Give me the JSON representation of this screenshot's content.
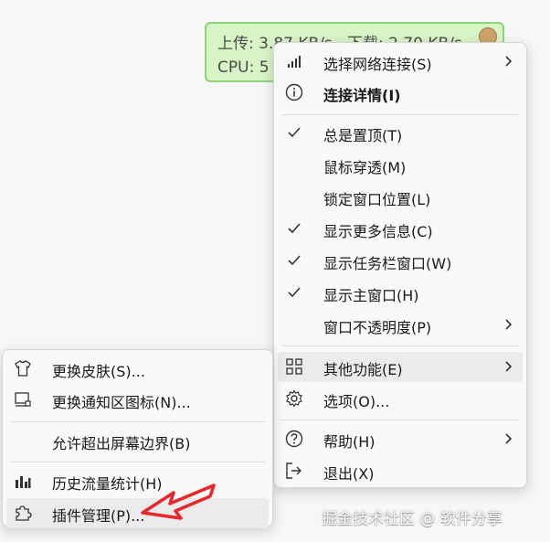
{
  "widget": {
    "upload_text": "上传: 3.87 KB/s",
    "download_text": "下载: 2.70 KB/s",
    "cpu_text": "CPU: 5"
  },
  "main_menu": {
    "items": [
      {
        "label": "选择网络连接(S)",
        "icon": "signal-bars-icon",
        "submenu": true
      },
      {
        "label": "连接详情(I)",
        "icon": "info-icon",
        "bold": true
      },
      {
        "label": "总是置顶(T)",
        "checked": true
      },
      {
        "label": "鼠标穿透(M)"
      },
      {
        "label": "锁定窗口位置(L)"
      },
      {
        "label": "显示更多信息(C)",
        "checked": true
      },
      {
        "label": "显示任务栏窗口(W)",
        "checked": true
      },
      {
        "label": "显示主窗口(H)",
        "checked": true
      },
      {
        "label": "窗口不透明度(P)",
        "submenu": true
      },
      {
        "label": "其他功能(E)",
        "icon": "grid-icon",
        "submenu": true,
        "highlighted": true
      },
      {
        "label": "选项(O)...",
        "icon": "gear-icon"
      },
      {
        "label": "帮助(H)",
        "icon": "help-icon",
        "submenu": true
      },
      {
        "label": "退出(X)",
        "icon": "exit-icon"
      }
    ]
  },
  "sub_menu": {
    "items": [
      {
        "label": "更换皮肤(S)...",
        "icon": "shirt-icon"
      },
      {
        "label": "更换通知区图标(N)...",
        "icon": "tray-icon"
      },
      {
        "label": "允许超出屏幕边界(B)"
      },
      {
        "label": "历史流量统计(H)",
        "icon": "bar-chart-icon"
      },
      {
        "label": "插件管理(P)...",
        "icon": "puzzle-icon",
        "highlighted": true
      }
    ]
  },
  "watermark": "掘金技术社区 @ 软件分享",
  "colors": {
    "widget_bg": "#d8f5c6",
    "widget_border": "#8fd27a",
    "menu_bg": "#f9f9f9",
    "highlight": "#ebebeb",
    "arrow": "#e8262c"
  }
}
